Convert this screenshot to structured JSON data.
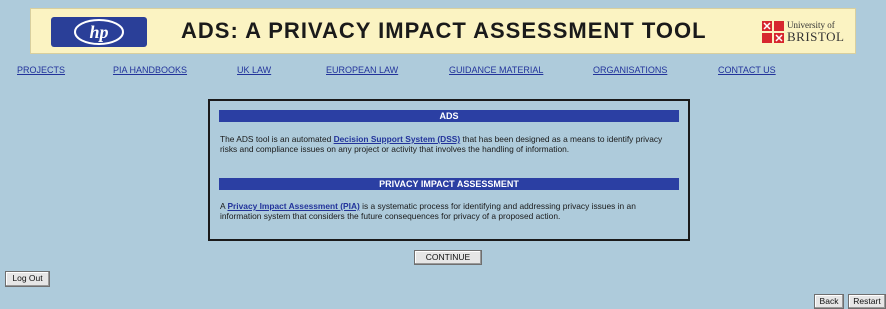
{
  "banner": {
    "hp_logo_text": "hp",
    "title": "ADS: A PRIVACY IMPACT ASSESSMENT TOOL",
    "university_line1": "University of",
    "university_line2": "BRISTOL"
  },
  "nav": {
    "items": [
      {
        "label": "PROJECTS"
      },
      {
        "label": "PIA HANDBOOKS"
      },
      {
        "label": "UK LAW"
      },
      {
        "label": "EUROPEAN LAW"
      },
      {
        "label": "GUIDANCE MATERIAL"
      },
      {
        "label": "ORGANISATIONS"
      },
      {
        "label": "CONTACT US"
      }
    ]
  },
  "dialog": {
    "ads_heading": "ADS",
    "ads_text_before": "The ADS tool is an automated ",
    "ads_link": "Decision Support System (DSS)",
    "ads_text_after": " that has been designed as a means to identify privacy risks and compliance issues on any project or activity that involves the handling of information.",
    "pia_heading": "PRIVACY IMPACT ASSESSMENT",
    "pia_text_before": "A ",
    "pia_link": "Privacy Impact Assessment (PIA)",
    "pia_text_after": " is a systematic process for identifying and addressing privacy issues in an information system that considers the future consequences for privacy of a proposed action."
  },
  "buttons": {
    "continue": "CONTINUE",
    "logout": "Log Out",
    "back": "Back",
    "restart": "Restart"
  },
  "colors": {
    "background": "#aecbdb",
    "banner": "#fbf3c2",
    "accent_blue": "#2b3fa3",
    "link": "#22339b"
  }
}
